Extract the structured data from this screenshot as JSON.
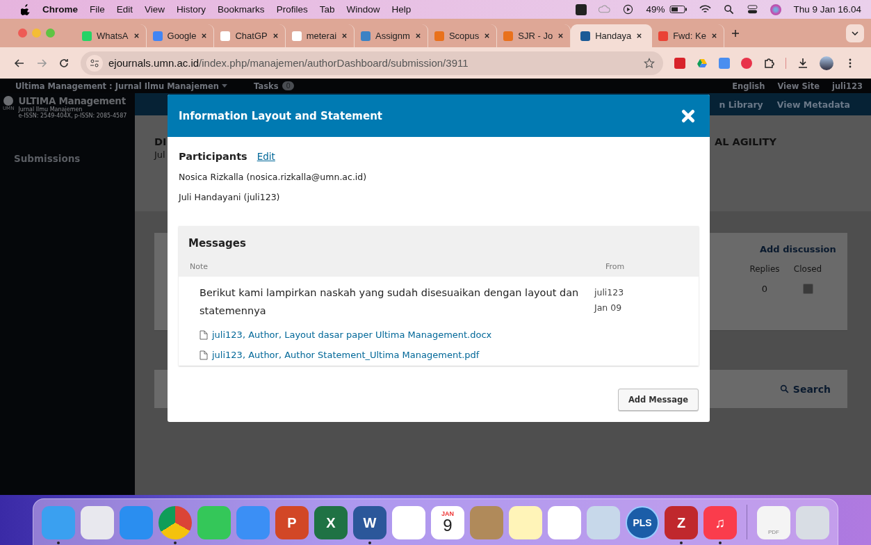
{
  "menu_bar": {
    "app": "Chrome",
    "menus": [
      "File",
      "Edit",
      "View",
      "History",
      "Bookmarks",
      "Profiles",
      "Tab",
      "Window",
      "Help"
    ],
    "battery": "49%",
    "clock": "Thu 9 Jan  16.04"
  },
  "tabs": [
    {
      "title": "WhatsA",
      "kind": "whatsapp",
      "selected": false
    },
    {
      "title": "Google",
      "kind": "translate",
      "selected": false
    },
    {
      "title": "ChatGP",
      "kind": "chatgpt",
      "selected": false
    },
    {
      "title": "meterai",
      "kind": "google",
      "selected": false
    },
    {
      "title": "Assignm",
      "kind": "assign",
      "selected": false
    },
    {
      "title": "Scopus",
      "kind": "sc",
      "selected": false
    },
    {
      "title": "SJR - Jo",
      "kind": "sjr",
      "selected": false
    },
    {
      "title": "Handaya",
      "kind": "ojs",
      "selected": true
    },
    {
      "title": "Fwd: Ke",
      "kind": "gmail",
      "selected": false
    }
  ],
  "address_bar": {
    "host": "ejournals.umn.ac.id",
    "path": "/index.php/manajemen/authorDashboard/submission/3911"
  },
  "site": {
    "context": "Ultima Management : Jurnal Ilmu Manajemen",
    "tasks_label": "Tasks",
    "tasks_count": "0",
    "language": "English",
    "view_site": "View Site",
    "user": "juli123",
    "logo_mark": "UMN",
    "logo_title": "ULTIMA Management",
    "logo_subtitle": "Jurnal Ilmu Manajemen",
    "logo_issn": "e-ISSN: 2549-404X, p-ISSN: 2085-4587",
    "sidebar": [
      "Submissions"
    ],
    "nav": [
      "n Library",
      "View Metadata"
    ],
    "title_start": "DI",
    "title_end": "AL AGILITY",
    "author_start": "Jul",
    "discussions": {
      "add": "Add discussion",
      "columns": [
        "Replies",
        "Closed"
      ],
      "rows": [
        {
          "replies": "0",
          "closed": false
        }
      ]
    },
    "search": "Search"
  },
  "modal": {
    "title": "Information Layout and Statement",
    "participants_label": "Participants",
    "edit": "Edit",
    "participants": [
      "Nosica Rizkalla (nosica.rizkalla@umn.ac.id)",
      "Juli Handayani (juli123)"
    ],
    "messages": {
      "title": "Messages",
      "columns": [
        "Note",
        "From"
      ],
      "rows": [
        {
          "note": "Berikut kami lampirkan naskah yang sudah disesuaikan dengan layout dan statemennya",
          "from": "juli123",
          "date": "Jan 09",
          "files": [
            "juli123, Author, Layout dasar paper Ultima Management.docx",
            "juli123, Author, Author Statement_Ultima Management.pdf"
          ]
        }
      ]
    },
    "button": "Add Message"
  },
  "dock": [
    {
      "kind": "finder",
      "running": true
    },
    {
      "kind": "launchpad",
      "running": false
    },
    {
      "kind": "safari",
      "running": false
    },
    {
      "kind": "chrome",
      "running": true
    },
    {
      "kind": "messages",
      "running": false
    },
    {
      "kind": "mail",
      "running": false
    },
    {
      "kind": "powerpoint",
      "label": "P",
      "running": false
    },
    {
      "kind": "excel",
      "label": "X",
      "running": false
    },
    {
      "kind": "word",
      "label": "W",
      "running": true
    },
    {
      "kind": "photos",
      "running": false
    },
    {
      "kind": "calendar",
      "month": "JAN",
      "label": "9",
      "running": false
    },
    {
      "kind": "contacts",
      "running": false
    },
    {
      "kind": "notes",
      "running": false
    },
    {
      "kind": "reminders",
      "running": false
    },
    {
      "kind": "preview",
      "running": false
    },
    {
      "kind": "pls",
      "label": "PLS",
      "running": false
    },
    {
      "kind": "zotero",
      "label": "Z",
      "running": true
    },
    {
      "kind": "music",
      "label": "♫",
      "running": true
    },
    {
      "kind": "separator"
    },
    {
      "kind": "document",
      "label": "PDF",
      "running": false
    },
    {
      "kind": "trash",
      "running": false
    }
  ]
}
